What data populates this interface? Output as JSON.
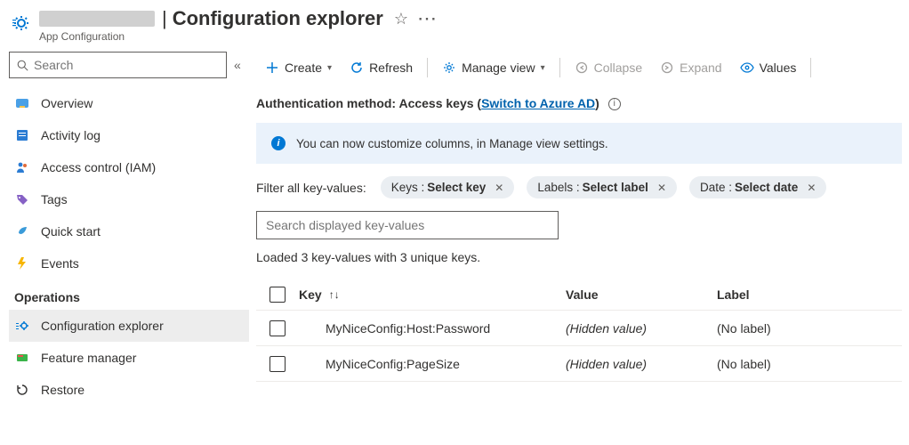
{
  "header": {
    "page_title": "Configuration explorer",
    "service": "App Configuration"
  },
  "sidebar": {
    "search_placeholder": "Search",
    "items": [
      {
        "label": "Overview"
      },
      {
        "label": "Activity log"
      },
      {
        "label": "Access control (IAM)"
      },
      {
        "label": "Tags"
      },
      {
        "label": "Quick start"
      },
      {
        "label": "Events"
      }
    ],
    "section_label": "Operations",
    "ops": [
      {
        "label": "Configuration explorer"
      },
      {
        "label": "Feature manager"
      },
      {
        "label": "Restore"
      }
    ]
  },
  "toolbar": {
    "create": "Create",
    "refresh": "Refresh",
    "manage_view": "Manage view",
    "collapse": "Collapse",
    "expand": "Expand",
    "values": "Values"
  },
  "auth": {
    "prefix": "Authentication method: Access keys (",
    "link": "Switch to Azure AD",
    "suffix": ")"
  },
  "banner": "You can now customize columns, in Manage view settings.",
  "filters": {
    "label": "Filter all key-values:",
    "keys_pre": "Keys : ",
    "keys_val": "Select key",
    "labels_pre": "Labels : ",
    "labels_val": "Select label",
    "date_pre": "Date : ",
    "date_val": "Select date"
  },
  "search_kv_placeholder": "Search displayed key-values",
  "loaded_text": "Loaded 3 key-values with 3 unique keys.",
  "table": {
    "col_key": "Key",
    "col_value": "Value",
    "col_label": "Label",
    "rows": [
      {
        "key": "MyNiceConfig:Host:Password",
        "value": "(Hidden value)",
        "label": "(No label)"
      },
      {
        "key": "MyNiceConfig:PageSize",
        "value": "(Hidden value)",
        "label": "(No label)"
      }
    ]
  }
}
